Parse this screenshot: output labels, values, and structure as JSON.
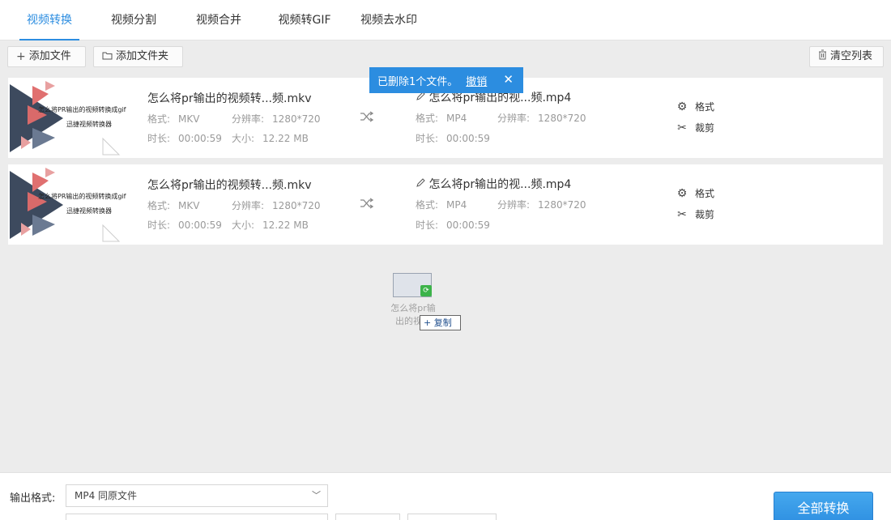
{
  "tabs": [
    {
      "label": "视频转换",
      "active": true
    },
    {
      "label": "视频分割",
      "active": false
    },
    {
      "label": "视频合并",
      "active": false
    },
    {
      "label": "视频转GIF",
      "active": false
    },
    {
      "label": "视频去水印",
      "active": false
    }
  ],
  "toolbar": {
    "add_file_label": "添加文件",
    "add_folder_label": "添加文件夹",
    "clear_list_label": "清空列表"
  },
  "toast": {
    "message": "已删除1个文件。",
    "undo_label": "撤销"
  },
  "files": [
    {
      "thumb_text1": "怎么将PR输出的视频转换成gif",
      "thumb_text2": "迅捷视频转换器",
      "source_name": "怎么将pr输出的视频转...频.mkv",
      "source_format_label": "格式:",
      "source_format": "MKV",
      "source_resolution_label": "分辨率:",
      "source_resolution": "1280*720",
      "source_duration_label": "时长:",
      "source_duration": "00:00:59",
      "size_label": "大小:",
      "size": "12.22 MB",
      "output_name": "怎么将pr输出的视...频.mp4",
      "output_format_label": "格式:",
      "output_format": "MP4",
      "output_resolution_label": "分辨率:",
      "output_resolution": "1280*720",
      "output_duration_label": "时长:",
      "output_duration": "00:00:59",
      "format_action": "格式",
      "crop_action": "裁剪"
    },
    {
      "thumb_text1": "怎么将PR输出的视频转换成gif",
      "thumb_text2": "迅捷视频转换器",
      "source_name": "怎么将pr输出的视频转...频.mkv",
      "source_format_label": "格式:",
      "source_format": "MKV",
      "source_resolution_label": "分辨率:",
      "source_resolution": "1280*720",
      "source_duration_label": "时长:",
      "source_duration": "00:00:59",
      "size_label": "大小:",
      "size": "12.22 MB",
      "output_name": "怎么将pr输出的视...频.mp4",
      "output_format_label": "格式:",
      "output_format": "MP4",
      "output_resolution_label": "分辨率:",
      "output_resolution": "1280*720",
      "output_duration_label": "时长:",
      "output_duration": "00:00:59",
      "format_action": "格式",
      "crop_action": "裁剪"
    }
  ],
  "drag": {
    "label_line1": "怎么将pr输",
    "label_line2": "出的视频",
    "copy_label": "复制"
  },
  "bottom": {
    "output_format_label": "输出格式:",
    "output_format_value": "MP4  同原文件",
    "convert_all_label": "全部转换"
  },
  "colors": {
    "accent": "#2c8de0",
    "background": "#ececec"
  }
}
